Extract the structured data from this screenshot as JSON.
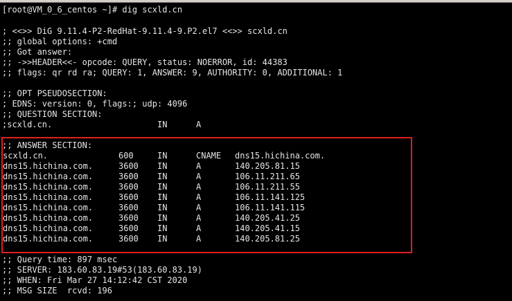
{
  "terminal": {
    "prompt": "[root@VM_0_6_centos ~]# dig scxld.cn",
    "header_lines": [
      "; <<>> DiG 9.11.4-P2-RedHat-9.11.4-9.P2.el7 <<>> scxld.cn",
      ";; global options: +cmd",
      ";; Got answer:",
      ";; ->>HEADER<<- opcode: QUERY, status: NOERROR, id: 44383",
      ";; flags: qr rd ra; QUERY: 1, ANSWER: 9, AUTHORITY: 0, ADDITIONAL: 1"
    ],
    "opt_lines": [
      ";; OPT PSEUDOSECTION:",
      "; EDNS: version: 0, flags:; udp: 4096",
      ";; QUESTION SECTION:"
    ],
    "question": {
      "name": ";scxld.cn.",
      "class": "IN",
      "type": "A"
    },
    "answer_section_label": ";; ANSWER SECTION:",
    "answers": [
      {
        "name": "scxld.cn.",
        "ttl": "600",
        "class": "IN",
        "type": "CNAME",
        "data": "dns15.hichina.com."
      },
      {
        "name": "dns15.hichina.com.",
        "ttl": "3600",
        "class": "IN",
        "type": "A",
        "data": "140.205.81.15"
      },
      {
        "name": "dns15.hichina.com.",
        "ttl": "3600",
        "class": "IN",
        "type": "A",
        "data": "106.11.211.65"
      },
      {
        "name": "dns15.hichina.com.",
        "ttl": "3600",
        "class": "IN",
        "type": "A",
        "data": "106.11.211.55"
      },
      {
        "name": "dns15.hichina.com.",
        "ttl": "3600",
        "class": "IN",
        "type": "A",
        "data": "106.11.141.125"
      },
      {
        "name": "dns15.hichina.com.",
        "ttl": "3600",
        "class": "IN",
        "type": "A",
        "data": "106.11.141.115"
      },
      {
        "name": "dns15.hichina.com.",
        "ttl": "3600",
        "class": "IN",
        "type": "A",
        "data": "140.205.41.25"
      },
      {
        "name": "dns15.hichina.com.",
        "ttl": "3600",
        "class": "IN",
        "type": "A",
        "data": "140.205.41.15"
      },
      {
        "name": "dns15.hichina.com.",
        "ttl": "3600",
        "class": "IN",
        "type": "A",
        "data": "140.205.81.25"
      }
    ],
    "footer_lines": [
      ";; Query time: 897 msec",
      ";; SERVER: 183.60.83.19#53(183.60.83.19)",
      ";; WHEN: Fri Mar 27 14:12:42 CST 2020",
      ";; MSG SIZE  rcvd: 196"
    ],
    "colors": {
      "background": "#000000",
      "text": "#e6e6e6",
      "highlight_box": "#e02020"
    }
  }
}
